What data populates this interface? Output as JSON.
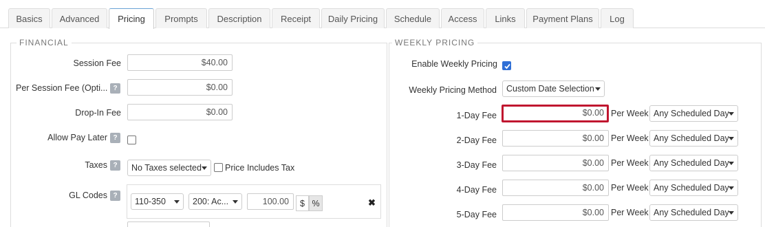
{
  "tabs": [
    "Basics",
    "Advanced",
    "Pricing",
    "Prompts",
    "Description",
    "Receipt",
    "Daily Pricing",
    "Schedule",
    "Access",
    "Links",
    "Payment Plans",
    "Log"
  ],
  "active_tab": "Pricing",
  "financial": {
    "legend": "FINANCIAL",
    "session_fee_label": "Session Fee",
    "session_fee_value": "$40.00",
    "per_session_fee_label": "Per Session Fee (Opti...",
    "per_session_fee_value": "$0.00",
    "drop_in_fee_label": "Drop-In Fee",
    "drop_in_fee_value": "$0.00",
    "allow_pay_later_label": "Allow Pay Later",
    "allow_pay_later_checked": false,
    "taxes_label": "Taxes",
    "taxes_value": "No Taxes selected",
    "price_includes_tax_label": "Price Includes Tax",
    "price_includes_tax_checked": false,
    "gl_codes_label": "GL Codes",
    "gl_code_value": "110-350",
    "gl_account_value": "200: Ac...",
    "gl_amount_value": "100.00",
    "gl_dollar_label": "$",
    "gl_percent_label": "%",
    "gl_remove_label": "✖",
    "help_label": "?"
  },
  "weekly": {
    "legend": "WEEKLY PRICING",
    "enable_label": "Enable Weekly Pricing",
    "enable_checked": true,
    "method_label": "Weekly Pricing Method",
    "method_value": "Custom Date Selection",
    "per_week_label": "Per Week",
    "fees": [
      {
        "label": "1-Day Fee",
        "value": "$0.00",
        "day": "Any Scheduled Day"
      },
      {
        "label": "2-Day Fee",
        "value": "$0.00",
        "day": "Any Scheduled Day"
      },
      {
        "label": "3-Day Fee",
        "value": "$0.00",
        "day": "Any Scheduled Day"
      },
      {
        "label": "4-Day Fee",
        "value": "$0.00",
        "day": "Any Scheduled Day"
      },
      {
        "label": "5-Day Fee",
        "value": "$0.00",
        "day": "Any Scheduled Day"
      }
    ]
  },
  "colors": {
    "highlight": "#c0152f",
    "checkbox_checked": "#2f6fd6",
    "active_tab_top": "#6aa3d5"
  }
}
